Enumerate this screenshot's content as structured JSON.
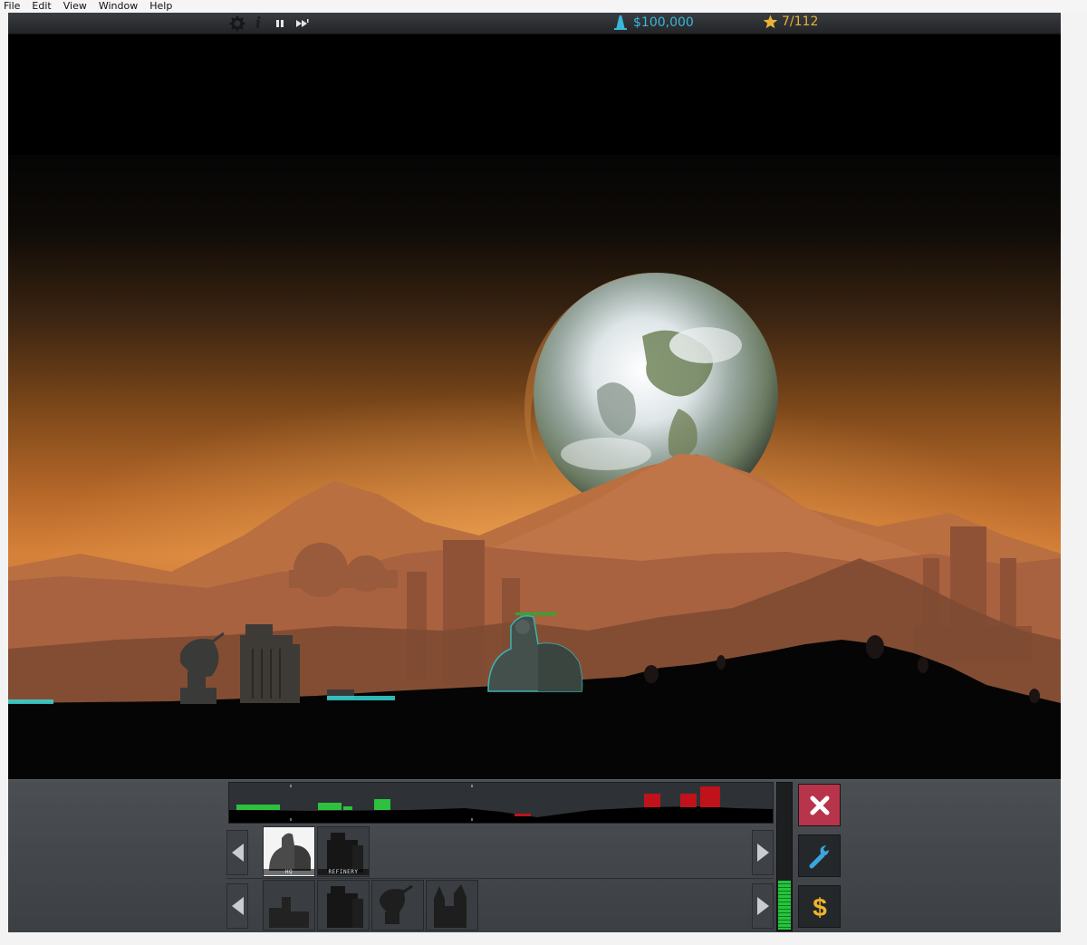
{
  "menu": {
    "items": [
      "File",
      "Edit",
      "View",
      "Window",
      "Help"
    ]
  },
  "hud": {
    "controls": [
      "settings-icon",
      "info-icon",
      "pause-icon",
      "fast-forward-icon"
    ],
    "money": "$100,000",
    "stars": "7/112"
  },
  "build_panel": {
    "row1": [
      {
        "label": "HQ",
        "icon": "hq-building-icon",
        "selected": true
      },
      {
        "label": "REFINERY",
        "icon": "refinery-building-icon",
        "selected": false
      }
    ],
    "row2": [
      {
        "label": "",
        "icon": "hq-building-icon"
      },
      {
        "label": "",
        "icon": "refinery-building-icon"
      },
      {
        "label": "",
        "icon": "radar-dish-icon"
      },
      {
        "label": "",
        "icon": "turret-building-icon"
      }
    ]
  },
  "power_level": 0.33,
  "side_buttons": {
    "cancel": "close-icon",
    "repair": "wrench-icon",
    "sell": "dollar-icon"
  },
  "colors": {
    "money": "#39b7d9",
    "stars": "#e8b23a",
    "cancel": "#b8344a",
    "friendly": "#2ec13d",
    "enemy": "#c0121a"
  }
}
